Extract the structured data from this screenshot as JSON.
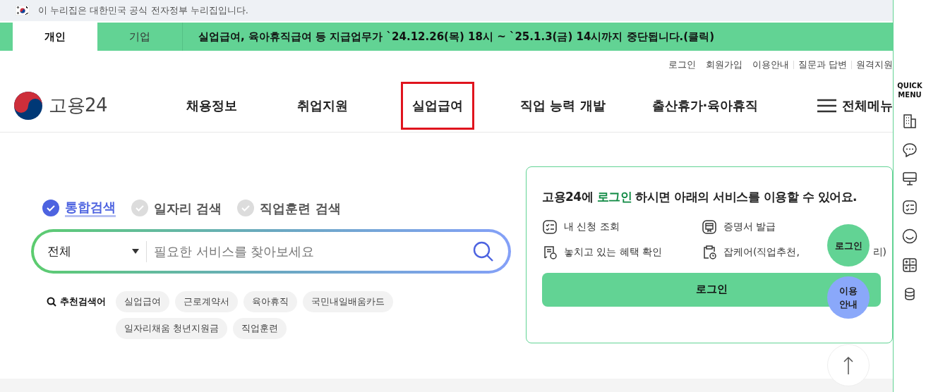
{
  "gov_banner": {
    "text": "이 누리집은 대한민국 공식 전자정부 누리집입니다."
  },
  "user_tabs": [
    {
      "label": "개인",
      "selected": true
    },
    {
      "label": "기업",
      "selected": false
    }
  ],
  "notice": "실업급여, 육아휴직급여 등 지급업무가 `24.12.26(목) 18시 ~ `25.1.3(금) 14시까지 중단됩니다.(클릭)",
  "utility_links": [
    "로그인",
    "회원가입",
    "이용안내",
    "질문과 답변",
    "원격지원"
  ],
  "logo": {
    "text": "고용24"
  },
  "nav": [
    {
      "label": "채용정보",
      "highlighted": false
    },
    {
      "label": "취업지원",
      "highlighted": false
    },
    {
      "label": "실업급여",
      "highlighted": true
    },
    {
      "label": "직업 능력 개발",
      "highlighted": false
    },
    {
      "label": "출산휴가·육아휴직",
      "highlighted": false
    }
  ],
  "all_menu": "전체메뉴",
  "search_tabs": [
    {
      "label": "통합검색",
      "selected": true
    },
    {
      "label": "일자리 검색",
      "selected": false
    },
    {
      "label": "직업훈련 검색",
      "selected": false
    }
  ],
  "search": {
    "category": "전체",
    "placeholder": "필요한 서비스를 찾아보세요"
  },
  "recommended": {
    "label": "추천검색어",
    "keywords": [
      "실업급여",
      "근로계약서",
      "육아휴직",
      "국민내일배움카드",
      "일자리채움 청년지원금",
      "직업훈련"
    ]
  },
  "login_card": {
    "message": "고용24에 **로그인** 하시면 아래의 서비스를 이용할 수 있어요.",
    "services": [
      {
        "kind": "checklist",
        "label": "내 신청 조회"
      },
      {
        "kind": "certificate",
        "label": "증명서 발급"
      },
      {
        "kind": "receipt",
        "label": "놓치고 있는 혜택 확인"
      },
      {
        "kind": "clipboard",
        "label": "잡케어(직업추천,",
        "label_tail": "리)"
      }
    ],
    "button": "로그인"
  },
  "floating": [
    {
      "label": "로그인",
      "color": "#62d394"
    },
    {
      "label": "이용\n안내",
      "color": "#8aa8fa"
    }
  ],
  "quick_menu": {
    "title": "QUICK\nMENU",
    "icons": [
      {
        "kind": "building"
      },
      {
        "kind": "chat"
      },
      {
        "kind": "monitor"
      },
      {
        "kind": "checklist"
      },
      {
        "kind": "smile"
      },
      {
        "kind": "calculator"
      },
      {
        "kind": "coins"
      }
    ]
  }
}
